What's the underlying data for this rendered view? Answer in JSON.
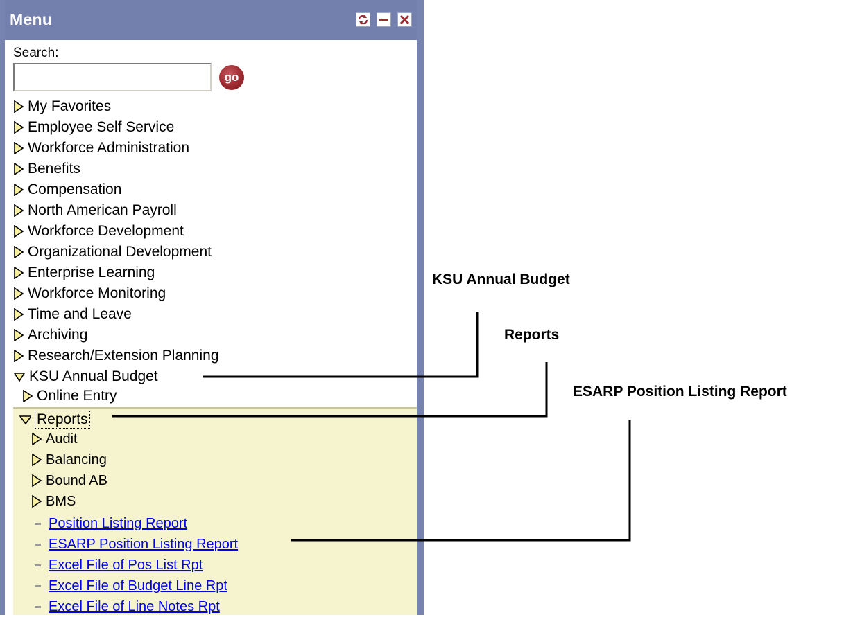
{
  "menu": {
    "title": "Menu",
    "buttons": {
      "refresh": "refresh-icon",
      "minimize": "minimize-icon",
      "close": "close-icon"
    },
    "search": {
      "label": "Search:",
      "value": "",
      "go_label": "go"
    },
    "items": [
      {
        "label": "My Favorites",
        "expanded": false
      },
      {
        "label": "Employee Self Service",
        "expanded": false
      },
      {
        "label": "Workforce Administration",
        "expanded": false
      },
      {
        "label": "Benefits",
        "expanded": false
      },
      {
        "label": "Compensation",
        "expanded": false
      },
      {
        "label": "North American Payroll",
        "expanded": false
      },
      {
        "label": "Workforce Development",
        "expanded": false
      },
      {
        "label": "Organizational Development",
        "expanded": false
      },
      {
        "label": "Enterprise Learning",
        "expanded": false
      },
      {
        "label": "Workforce Monitoring",
        "expanded": false
      },
      {
        "label": "Time and Leave",
        "expanded": false
      },
      {
        "label": "Archiving",
        "expanded": false
      },
      {
        "label": "Research/Extension Planning",
        "expanded": false
      },
      {
        "label": "KSU Annual Budget",
        "expanded": true
      }
    ],
    "budget_children": {
      "online_entry": "Online Entry",
      "reports": "Reports"
    },
    "report_folders": [
      "Audit",
      "Balancing",
      "Bound AB",
      "BMS"
    ],
    "report_links": [
      "Position Listing Report",
      "ESARP Position Listing Report",
      "Excel File of Pos List Rpt",
      "Excel File of Budget Line Rpt",
      "Excel File of Line Notes Rpt"
    ]
  },
  "callouts": {
    "budget": "KSU Annual Budget",
    "reports": "Reports",
    "esarp": "ESARP Position Listing Report"
  },
  "colors": {
    "header": "#7380ad",
    "border": "#7784b0",
    "reports_bg": "#f6f4cf",
    "link": "#0000ee",
    "triangle_fill": "#f8f0a0"
  }
}
